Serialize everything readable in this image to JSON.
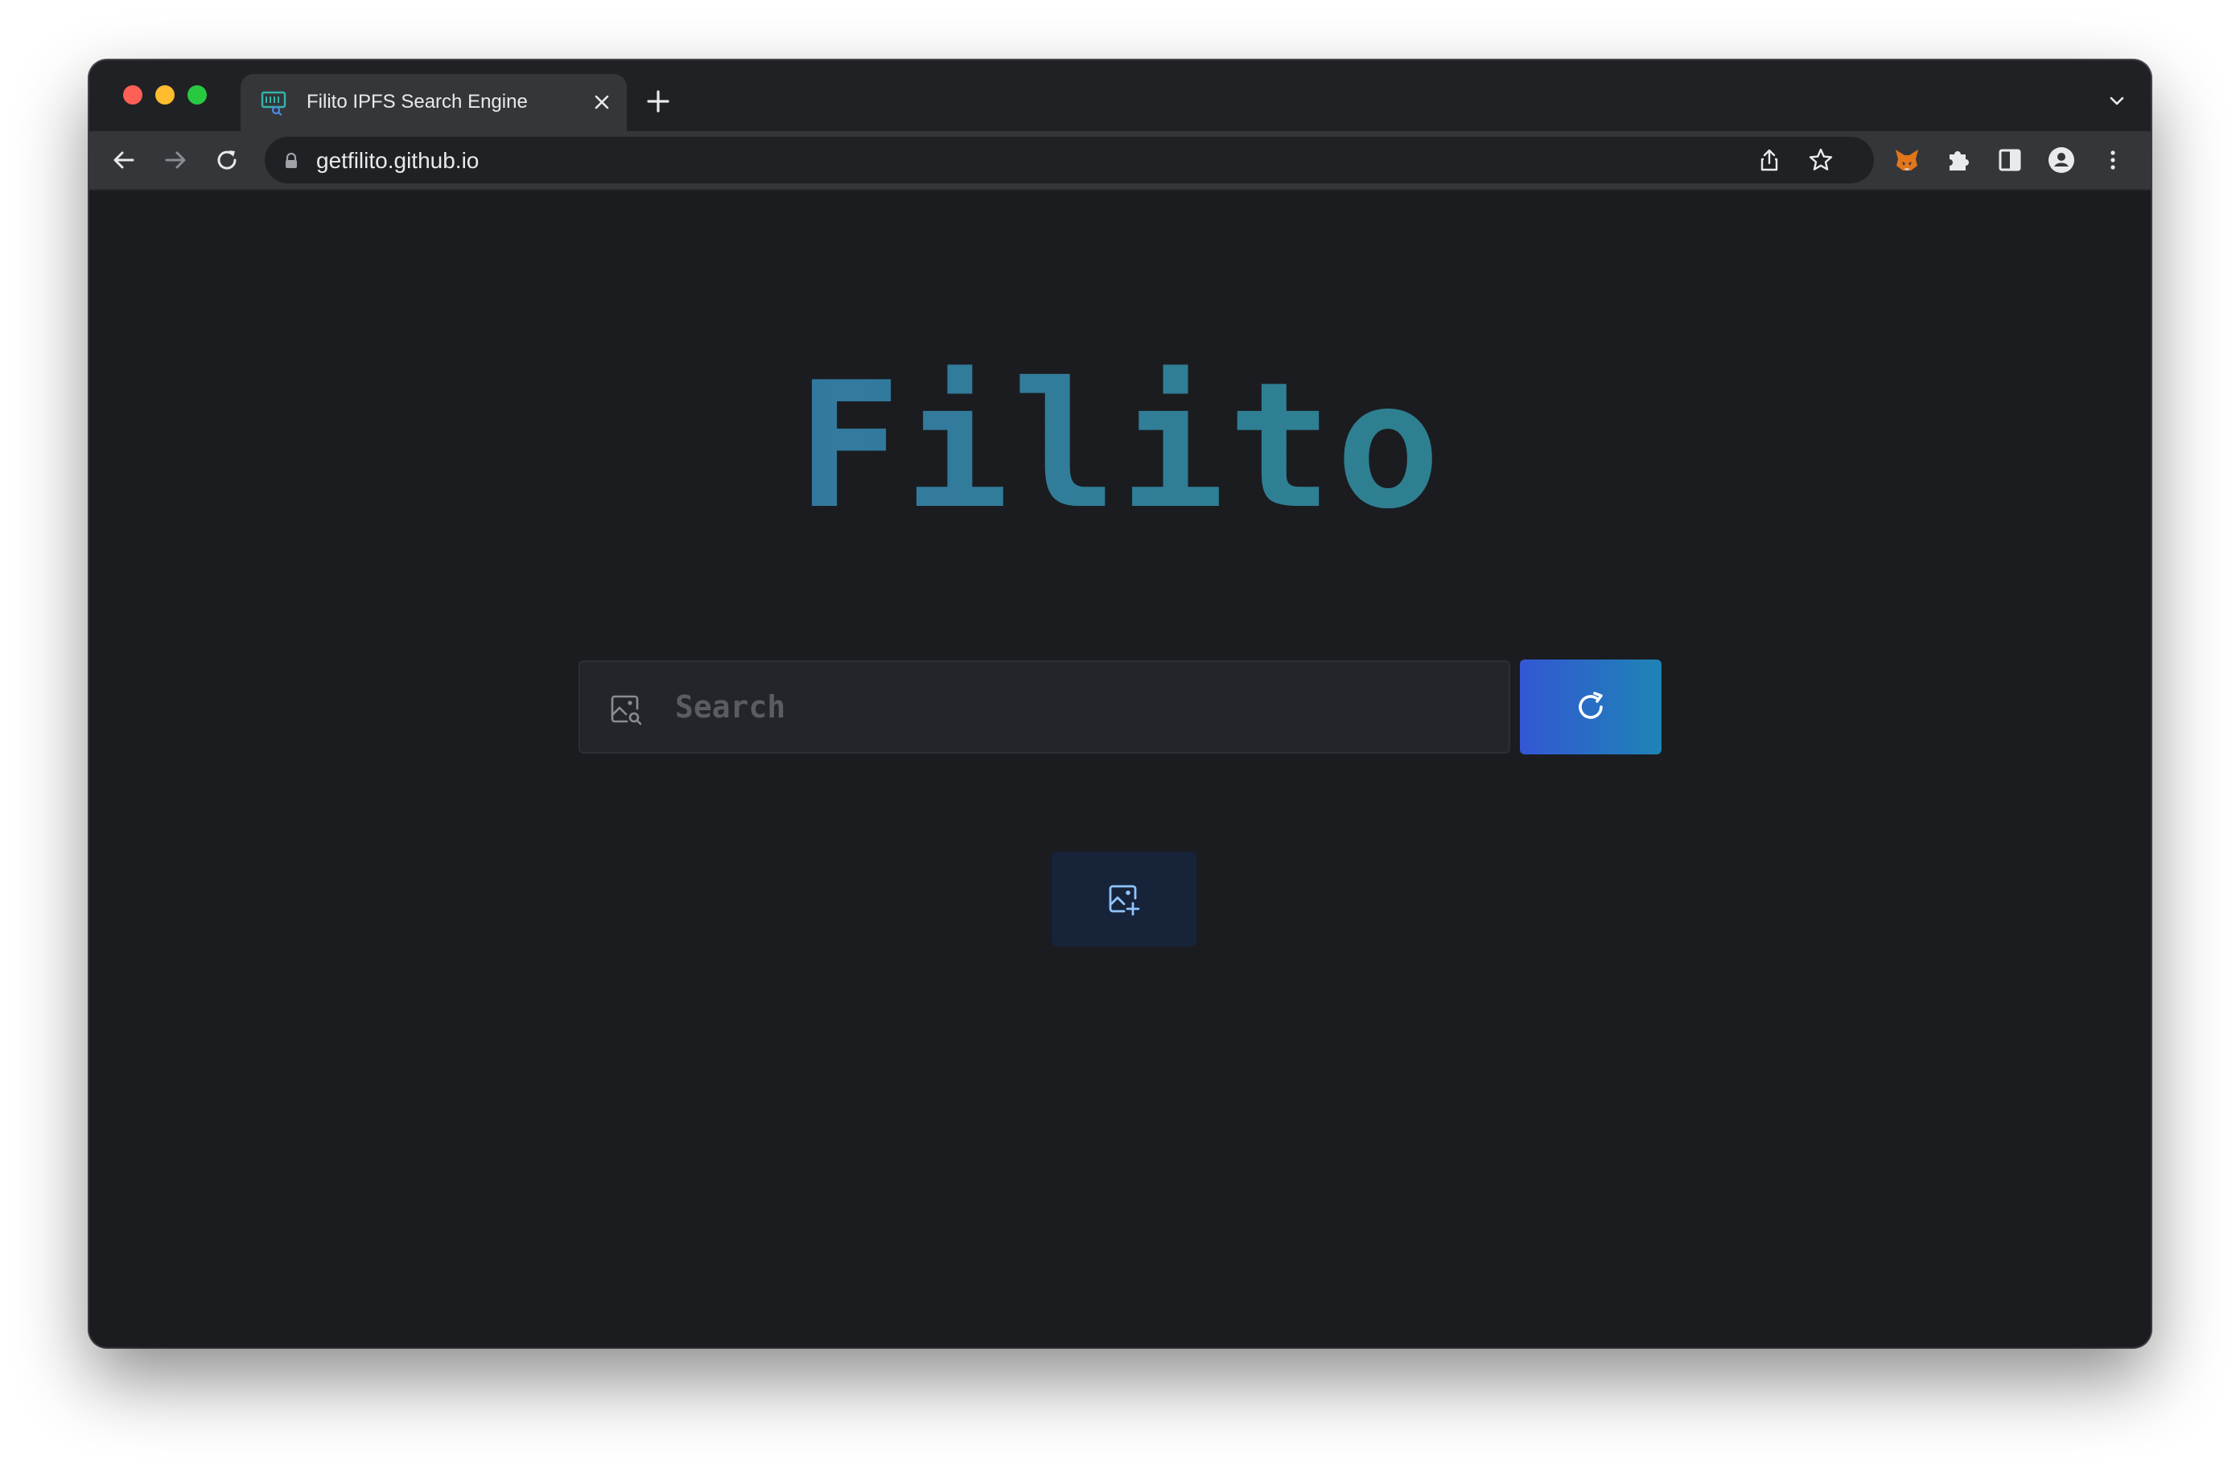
{
  "browser": {
    "tab": {
      "title": "Filito IPFS Search Engine",
      "favicon": "filito-favicon-icon"
    },
    "address_bar": {
      "url": "getfilito.github.io"
    },
    "icons": {
      "back": "arrow-left-icon",
      "forward": "arrow-right-icon",
      "reload": "reload-icon",
      "share": "share-icon",
      "bookmark": "star-icon",
      "metamask": "fox-icon",
      "extensions": "puzzle-icon",
      "side_panel": "side-panel-icon",
      "profile": "person-icon",
      "menu": "kebab-menu-icon"
    }
  },
  "page": {
    "logo_text": "Filito",
    "search": {
      "placeholder": "Search",
      "value": ""
    },
    "buttons": {
      "refresh": "refresh-icon",
      "upload": "image-plus-icon"
    },
    "colors": {
      "background": "#1b1c20",
      "logo_gradient_start": "#3a6fb0",
      "logo_gradient_end": "#2a857d",
      "refresh_gradient_start": "#3357d4",
      "refresh_gradient_end": "#1e84b5",
      "upload_bg": "#172339"
    }
  }
}
